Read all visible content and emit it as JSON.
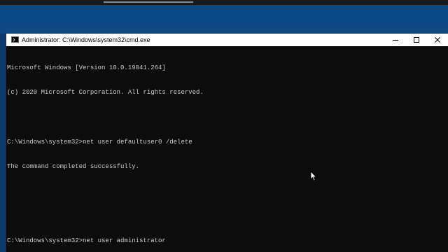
{
  "window": {
    "title": "Administrator: C:\\Windows\\system32\\cmd.exe",
    "minimize_symbol": "—",
    "maximize_symbol": "☐",
    "close_symbol": "✕"
  },
  "console": {
    "lines": [
      "Microsoft Windows [Version 10.0.19041.264]",
      "(c) 2020 Microsoft Corporation. All rights reserved.",
      "",
      "C:\\Windows\\system32>net user defaultuser0 /delete",
      "The command completed successfully.",
      "",
      "",
      "C:\\Windows\\system32>net user administrator"
    ]
  },
  "icons": {
    "app": "cmd-icon",
    "cursor": "mouse-pointer-icon"
  },
  "colors": {
    "console_bg": "#0c0c0c",
    "console_text": "#cccccc",
    "titlebar_bg": "#ffffff",
    "desktop": "#0b4a88"
  }
}
